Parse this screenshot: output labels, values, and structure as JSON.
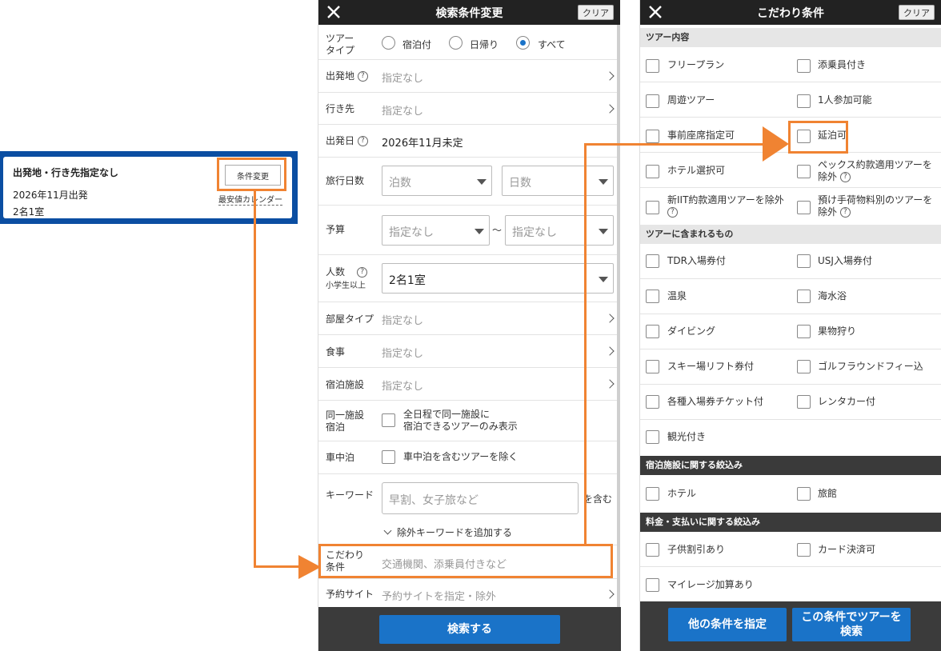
{
  "summary": {
    "title": "出発地・行き先指定なし",
    "date": "2026年11月出発",
    "people": "2名1室",
    "change_button": "条件変更",
    "calendar_link": "最安値カレンダー"
  },
  "search": {
    "header": "検索条件変更",
    "clear": "クリア",
    "tour_type_label": "ツアー\nタイプ",
    "tour_type_options": [
      "宿泊付",
      "日帰り",
      "すべて"
    ],
    "tour_type_selected": "すべて",
    "departure_label": "出発地",
    "departure_value": "指定なし",
    "destination_label": "行き先",
    "destination_value": "指定なし",
    "date_label": "出発日",
    "date_value": "2026年11月未定",
    "days_label": "旅行日数",
    "nights_placeholder": "泊数",
    "days_placeholder": "日数",
    "budget_label": "予算",
    "budget_min": "指定なし",
    "budget_sep": "〜",
    "budget_max": "指定なし",
    "people_label": "人数",
    "people_sub": "小学生以上",
    "people_value": "2名1室",
    "room_label": "部屋タイプ",
    "room_value": "指定なし",
    "meal_label": "食事",
    "meal_value": "指定なし",
    "facility_label": "宿泊施設",
    "facility_value": "指定なし",
    "same_label": "同一施設\n宿泊",
    "same_text": "全日程で同一施設に\n宿泊できるツアーのみ表示",
    "car_label": "車中泊",
    "car_text": "車中泊を含むツアーを除く",
    "keyword_label": "キーワード",
    "keyword_placeholder": "早割、女子旅など",
    "keyword_suffix": "を含む",
    "exclude_keyword": "除外キーワードを追加する",
    "kodawari_label": "こだわり\n条件",
    "kodawari_value": "交通機関、添乗員付きなど",
    "site_label": "予約サイト",
    "site_value": "予約サイトを指定・除外",
    "search_button": "検索する"
  },
  "kodawari": {
    "header": "こだわり条件",
    "clear": "クリア",
    "sections": [
      {
        "title": "ツアー内容",
        "items": [
          "フリープラン",
          "添乗員付き",
          "周遊ツアー",
          "1人参加可能",
          "事前座席指定可",
          "延泊可",
          "ホテル選択可",
          "ペックス約款適用ツアーを除外",
          "新IIT約款適用ツアーを除外",
          "預け手荷物料別のツアーを除外"
        ]
      },
      {
        "title": "ツアーに含まれるもの",
        "items": [
          "TDR入場券付",
          "USJ入場券付",
          "温泉",
          "海水浴",
          "ダイビング",
          "果物狩り",
          "スキー場リフト券付",
          "ゴルフラウンドフィー込",
          "各種入場券チケット付",
          "レンタカー付",
          "観光付き"
        ]
      },
      {
        "title": "宿泊施設に関する絞込み",
        "items": [
          "ホテル",
          "旅館"
        ]
      },
      {
        "title": "料金・支払いに関する絞込み",
        "items": [
          "子供割引あり",
          "カード決済可",
          "マイレージ加算あり"
        ]
      }
    ],
    "other_button": "他の条件を指定",
    "search_button": "この条件でツアーを\n検索"
  },
  "colors": {
    "accent": "#f08332",
    "primary": "#1a73c8",
    "summary_bg": "#0b4ea2",
    "topbar": "#222222"
  }
}
